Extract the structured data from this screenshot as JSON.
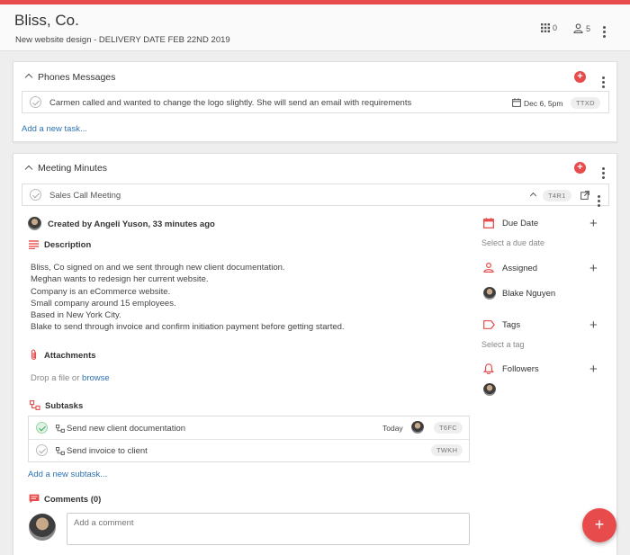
{
  "header": {
    "title": "Bliss, Co.",
    "subtitle": "New website design - DELIVERY DATE FEB 22ND 2019",
    "task_count": "0",
    "member_count": "5"
  },
  "phones": {
    "title": "Phones Messages",
    "task_text": "Carmen called and wanted to change the logo slightly. She will send an email with requirements",
    "task_date": "Dec 6, 5pm",
    "task_id": "TTXD",
    "add_task": "Add a new task..."
  },
  "meeting": {
    "title": "Meeting Minutes",
    "task_title": "Sales Call Meeting",
    "task_id": "T4R1",
    "created_by": "Created by Angeli Yuson, 33 minutes ago",
    "description_label": "Description",
    "description_lines": [
      "Bliss, Co signed on and we sent through new client documentation.",
      "Meghan wants to redesign her current website.",
      "Company is an eCommerce website.",
      "Small company around 15 employees.",
      "Based in New York City.",
      "Blake to send through invoice and confirm initiation payment before getting started."
    ],
    "attachments_label": "Attachments",
    "drop_text": "Drop a file or",
    "browse": "browse",
    "subtasks_label": "Subtasks",
    "subtasks": [
      {
        "text": "Send new client documentation",
        "due": "Today",
        "id": "T6FC",
        "done": true
      },
      {
        "text": "Send invoice to client",
        "due": "",
        "id": "TWKH",
        "done": false
      }
    ],
    "add_subtask": "Add a new subtask...",
    "comments_label": "Comments (0)",
    "comment_placeholder": "Add a comment"
  },
  "sidebar": {
    "due_date_label": "Due Date",
    "due_date_hint": "Select a due date",
    "assigned_label": "Assigned",
    "assigned_name": "Blake Nguyen",
    "tags_label": "Tags",
    "tags_hint": "Select a tag",
    "followers_label": "Followers"
  },
  "colors": {
    "accent": "#e84b4b",
    "link": "#2f73b5",
    "done_green": "#3aa757"
  },
  "fab_label": "+"
}
